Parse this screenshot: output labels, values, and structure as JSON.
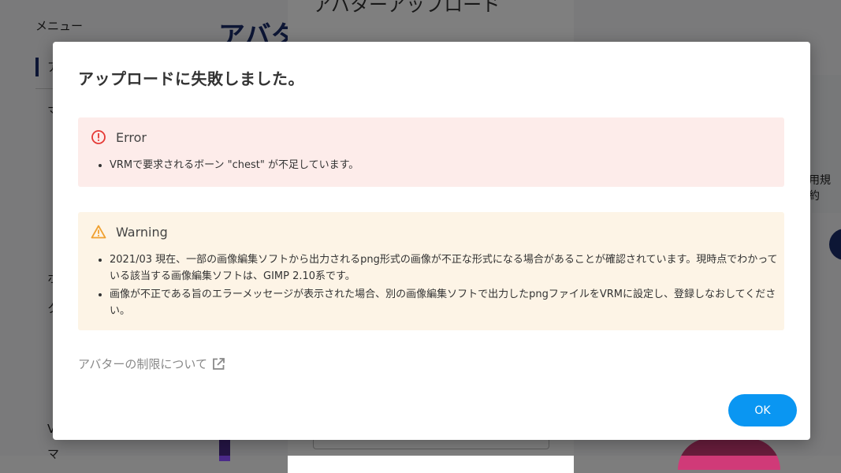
{
  "background": {
    "sidebar_title": "メニュー",
    "sidebar_items": [
      "ア",
      "マ",
      "ホ",
      "ク",
      "V",
      "マ"
    ],
    "page_title": "アバタ",
    "modal_title": "アバターアップロード",
    "right_text": "用規約"
  },
  "dialog": {
    "title": "アップロードに失敗しました。",
    "error": {
      "heading": "Error",
      "items": [
        "VRMで要求されるボーン \"chest\" が不足しています。"
      ]
    },
    "warning": {
      "heading": "Warning",
      "items": [
        "2021/03 現在、一部の画像編集ソフトから出力されるpng形式の画像が不正な形式になる場合があることが確認されています。現時点でわかっている該当する画像編集ソフトは、GIMP 2.10系です。",
        "画像が不正である旨のエラーメッセージが表示された場合、別の画像編集ソフトで出力したpngファイルをVRMに設定し、登録しなおしてください。"
      ]
    },
    "limits_link": "アバターの制限について",
    "ok_label": "OK"
  },
  "colors": {
    "error_bg": "#fdecea",
    "error_icon": "#e53935",
    "warning_bg": "#fdf4e6",
    "warning_icon": "#f0a030",
    "primary": "#0a96f2",
    "link": "#888888"
  },
  "icons": {
    "error": "error-circle-icon",
    "warning": "warning-triangle-icon",
    "external": "external-link-icon"
  }
}
